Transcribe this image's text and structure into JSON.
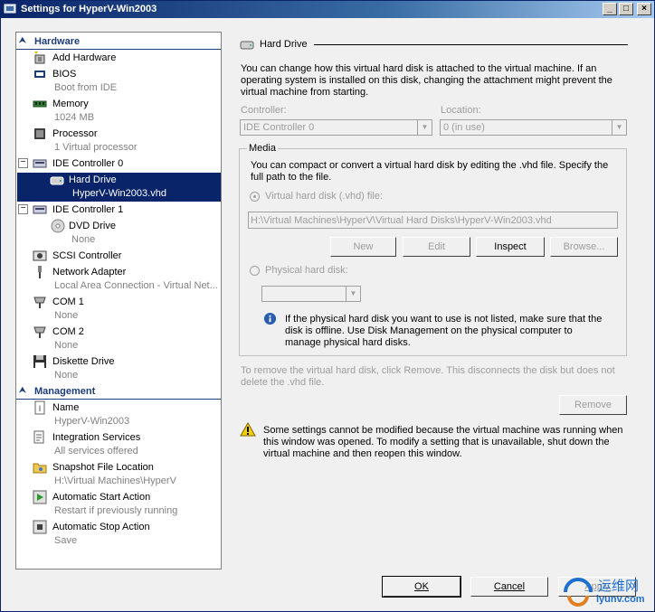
{
  "window": {
    "title": "Settings for HyperV-Win2003",
    "min": "_",
    "max": "□",
    "close": "×"
  },
  "tree": {
    "hardware_header": "Hardware",
    "management_header": "Management",
    "items": [
      {
        "label": "Add Hardware",
        "sub": ""
      },
      {
        "label": "BIOS",
        "sub": "Boot from IDE"
      },
      {
        "label": "Memory",
        "sub": "1024 MB"
      },
      {
        "label": "Processor",
        "sub": "1 Virtual processor"
      },
      {
        "label": "IDE Controller 0",
        "sub": ""
      },
      {
        "label": "Hard Drive",
        "sub": "HyperV-Win2003.vhd"
      },
      {
        "label": "IDE Controller 1",
        "sub": ""
      },
      {
        "label": "DVD Drive",
        "sub": "None"
      },
      {
        "label": "SCSI Controller",
        "sub": ""
      },
      {
        "label": "Network Adapter",
        "sub": "Local Area Connection - Virtual Net..."
      },
      {
        "label": "COM 1",
        "sub": "None"
      },
      {
        "label": "COM 2",
        "sub": "None"
      },
      {
        "label": "Diskette Drive",
        "sub": "None"
      }
    ],
    "mgmt_items": [
      {
        "label": "Name",
        "sub": "HyperV-Win2003"
      },
      {
        "label": "Integration Services",
        "sub": "All services offered"
      },
      {
        "label": "Snapshot File Location",
        "sub": "H:\\Virtual Machines\\HyperV"
      },
      {
        "label": "Automatic Start Action",
        "sub": "Restart if previously running"
      },
      {
        "label": "Automatic Stop Action",
        "sub": "Save"
      }
    ]
  },
  "panel": {
    "title": "Hard Drive",
    "intro": "You can change how this virtual hard disk is attached to the virtual machine. If an operating system is installed on this disk, changing the attachment might prevent the virtual machine from starting.",
    "controller_label": "Controller:",
    "controller_value": "IDE Controller 0",
    "location_label": "Location:",
    "location_value": "0 (in use)",
    "media_label": "Media",
    "media_desc": "You can compact or convert a virtual hard disk by editing the .vhd file. Specify the full path to the file.",
    "vhd_radio": "Virtual hard disk (.vhd) file:",
    "vhd_path": "H:\\Virtual Machines\\HyperV\\Virtual Hard Disks\\HyperV-Win2003.vhd",
    "btn_new": "New",
    "btn_edit": "Edit",
    "btn_inspect": "Inspect",
    "btn_browse": "Browse...",
    "phys_radio": "Physical hard disk:",
    "phys_value": "",
    "info_text": "If the physical hard disk you want to use is not listed, make sure that the disk is offline. Use Disk Management on the physical computer to manage physical hard disks.",
    "remove_text": "To remove the virtual hard disk, click Remove. This disconnects the disk but does not delete the .vhd file.",
    "btn_remove": "Remove",
    "warn_text": "Some settings cannot be modified because the virtual machine was running when this window was opened. To modify a setting that is unavailable, shut down the virtual machine and then reopen this window."
  },
  "footer": {
    "ok": "OK",
    "cancel": "Cancel",
    "apply": "Apply"
  },
  "watermark": {
    "cn": "运维网",
    "url": "iyunv.com"
  },
  "colors": {
    "selection": "#0a246a",
    "header": "#1e3c78",
    "disabled": "#9d9d9d"
  }
}
